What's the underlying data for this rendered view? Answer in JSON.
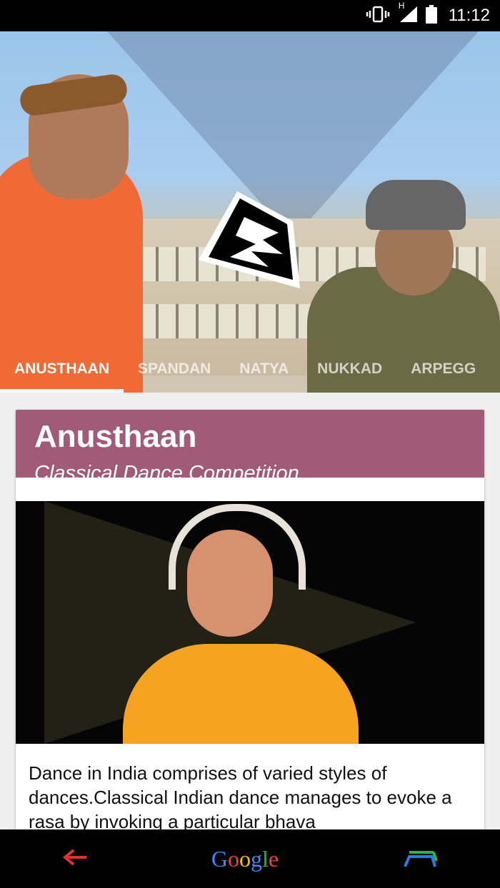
{
  "status_bar": {
    "time": "11:12",
    "network_label": "H"
  },
  "hero": {
    "tabs": [
      {
        "label": "ANUSTHAAN",
        "active": true
      },
      {
        "label": "SPANDAN",
        "active": false
      },
      {
        "label": "NATYA",
        "active": false
      },
      {
        "label": "NUKKAD",
        "active": false
      },
      {
        "label": "ARPEGG",
        "active": false
      }
    ]
  },
  "card": {
    "title": "Anusthaan",
    "subtitle": "Classical Dance Competition",
    "description": "Dance in India comprises of varied styles of dances.Classical Indian dance manages to evoke a rasa by invoking a particular bhava",
    "header_color": "#a15a78"
  },
  "nav_bar": {
    "back_icon": "back-arrow-icon",
    "home_label": "Google",
    "recents_icon": "launcher-icon"
  }
}
